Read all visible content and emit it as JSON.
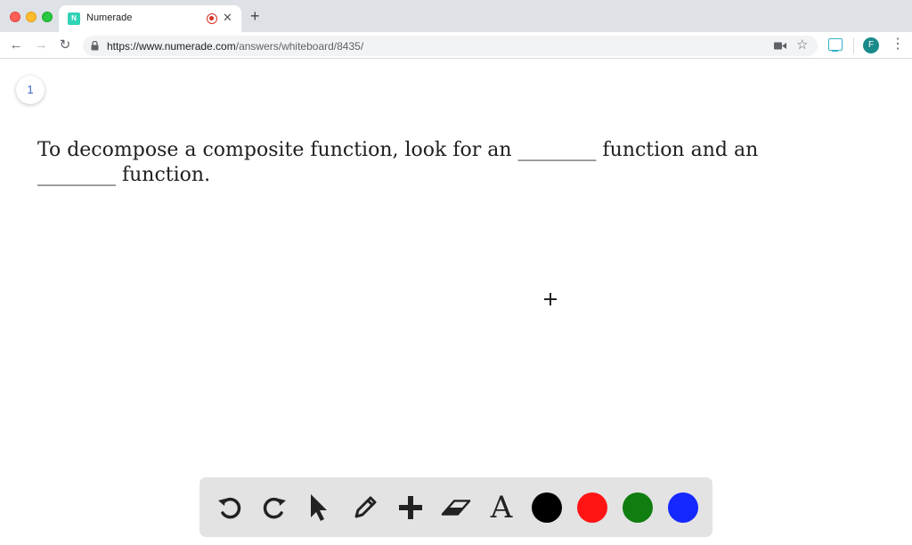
{
  "browser": {
    "tab": {
      "title": "Numerade",
      "favicon_text": "N"
    },
    "new_tab_symbol": "+",
    "close_symbol": "✕",
    "url": {
      "host": "https://www.numerade.com",
      "path": "/answers/whiteboard/8435/"
    },
    "profile_initial": "F",
    "menu_symbol": "⋮",
    "star_symbol": "☆",
    "nav": {
      "back": "←",
      "forward": "→",
      "reload": "↻"
    }
  },
  "whiteboard": {
    "page_number": "1",
    "question_text": "To decompose a composite function, look for an ________ function and an ________ function."
  },
  "tools": [
    {
      "name": "undo-icon"
    },
    {
      "name": "redo-icon"
    },
    {
      "name": "pointer-icon"
    },
    {
      "name": "pencil-icon"
    },
    {
      "name": "plus-icon"
    },
    {
      "name": "eraser-icon"
    },
    {
      "name": "text-icon",
      "glyph": "A"
    }
  ],
  "colors": {
    "swatches": [
      "#000000",
      "#ff1414",
      "#0f7d0f",
      "#1428ff"
    ],
    "page_badge": "#3a67c9",
    "favicon": "#2fd3b5"
  }
}
